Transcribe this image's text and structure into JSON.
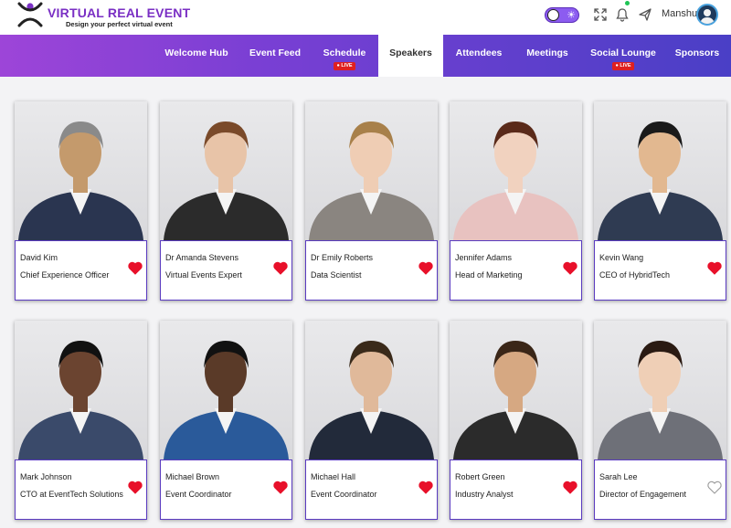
{
  "brand": {
    "title": "VIRTUAL REAL EVENT",
    "subtitle": "Design your perfect virtual event"
  },
  "header": {
    "username": "Manshu"
  },
  "nav": [
    {
      "label": "Welcome Hub",
      "live": false,
      "active": false
    },
    {
      "label": "Event Feed",
      "live": false,
      "active": false
    },
    {
      "label": "Schedule",
      "live": true,
      "active": false
    },
    {
      "label": "Speakers",
      "live": false,
      "active": true
    },
    {
      "label": "Attendees",
      "live": false,
      "active": false
    },
    {
      "label": "Meetings",
      "live": false,
      "active": false
    },
    {
      "label": "Social Lounge",
      "live": true,
      "active": false
    },
    {
      "label": "Sponsors",
      "live": false,
      "active": false
    }
  ],
  "live_label": "LIVE",
  "speakers": [
    {
      "name": "David Kim",
      "role": "Chief Experience Officer",
      "favorited": true
    },
    {
      "name": "Dr Amanda Stevens",
      "role": "Virtual Events Expert",
      "favorited": true
    },
    {
      "name": "Dr Emily Roberts",
      "role": "Data Scientist",
      "favorited": true
    },
    {
      "name": "Jennifer Adams",
      "role": "Head of Marketing",
      "favorited": true
    },
    {
      "name": "Kevin Wang",
      "role": "CEO of HybridTech",
      "favorited": true
    },
    {
      "name": "Mark Johnson",
      "role": "CTO at EventTech Solutions",
      "favorited": true
    },
    {
      "name": "Michael Brown",
      "role": "Event Coordinator",
      "favorited": true
    },
    {
      "name": "Michael Hall",
      "role": "Event Coordinator",
      "favorited": true
    },
    {
      "name": "Robert Green",
      "role": "Industry Analyst",
      "favorited": true
    },
    {
      "name": "Sarah Lee",
      "role": "Director of Engagement",
      "favorited": false
    }
  ],
  "colors": {
    "brand": "#7a2fc4",
    "nav_start": "#9d45d8",
    "nav_end": "#4a3fc6",
    "heart": "#e8102a",
    "card_border": "#5a3bc0"
  }
}
